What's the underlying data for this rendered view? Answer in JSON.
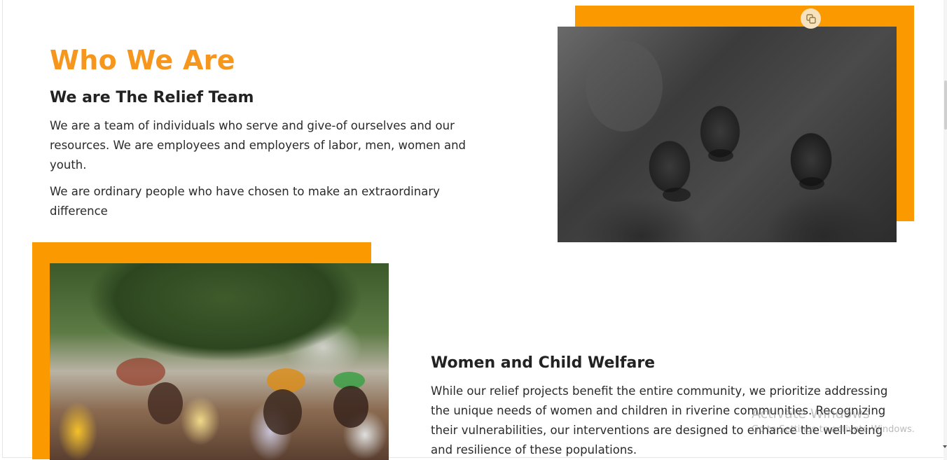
{
  "about": {
    "title": "Who We Are",
    "subtitle": "We are The Relief Team",
    "paragraph_1": "We are a team of individuals who serve and give-of ourselves and our resources. We are employees and employers of labor, men, women and youth.",
    "paragraph_2": "We are ordinary people who have chosen to make an extraordinary difference"
  },
  "welfare": {
    "heading": "Women and Child Welfare",
    "paragraph": "While our relief projects benefit the entire community, we prioritize addressing the unique needs of women and children in riverine communities. Recognizing their vulnerabilities, our interventions are designed to enhance the well-being and resilience of these populations."
  },
  "watermark": {
    "line1": "Activate Windows",
    "line2": "Go to Settings to activate Windows."
  },
  "colors": {
    "accent": "#f7961d",
    "frame": "#fb9a00",
    "text": "#222222"
  },
  "icons": {
    "overlay": "copy-icon"
  }
}
